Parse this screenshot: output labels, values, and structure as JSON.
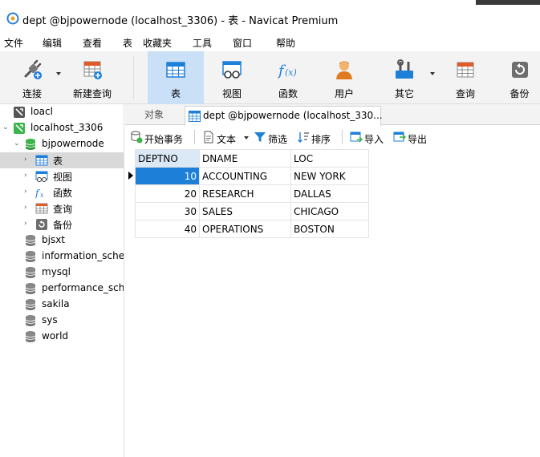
{
  "window": {
    "title": "dept @bjpowernode (localhost_3306) - 表 - Navicat Premium"
  },
  "menu": [
    "文件",
    "编辑",
    "查看",
    "表",
    "收藏夹",
    "工具",
    "窗口",
    "帮助"
  ],
  "toolbar": {
    "connect": "连接",
    "new_query": "新建查询",
    "table": "表",
    "view": "视图",
    "function": "函数",
    "user": "用户",
    "other": "其它",
    "query": "查询",
    "backup": "备份"
  },
  "sidebar": {
    "loacl": "loacl",
    "localhost": "localhost_3306",
    "bjpowernode": "bjpowernode",
    "children": [
      "表",
      "视图",
      "函数",
      "查询",
      "备份"
    ],
    "databases": [
      "bjsxt",
      "information_schema",
      "mysql",
      "performance_schema",
      "sakila",
      "sys",
      "world"
    ]
  },
  "tabs": {
    "objects": "对象",
    "active": "dept @bjpowernode (localhost_330..."
  },
  "subtoolbar": {
    "begin_transaction": "开始事务",
    "text": "文本",
    "filter": "筛选",
    "sort": "排序",
    "import": "导入",
    "export": "导出"
  },
  "grid": {
    "columns": [
      "DEPTNO",
      "DNAME",
      "LOC"
    ],
    "rows": [
      [
        "10",
        "ACCOUNTING",
        "NEW YORK"
      ],
      [
        "20",
        "RESEARCH",
        "DALLAS"
      ],
      [
        "30",
        "SALES",
        "CHICAGO"
      ],
      [
        "40",
        "OPERATIONS",
        "BOSTON"
      ]
    ]
  },
  "colors": {
    "accent": "#1e7fd9",
    "active_button": "#c9e0f6",
    "selection": "#d9d9d9"
  }
}
